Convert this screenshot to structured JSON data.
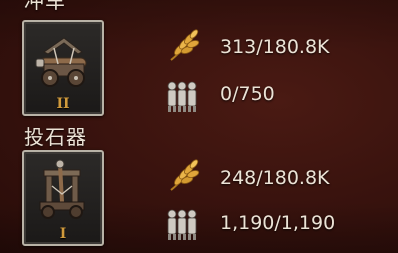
{
  "units": [
    {
      "name": "冲车",
      "tier": "II",
      "icon": "battering-ram-icon",
      "food": "313/180.8K",
      "troops": "0/750"
    },
    {
      "name": "投石器",
      "tier": "I",
      "icon": "catapult-icon",
      "food": "248/180.8K",
      "troops": "1,190/1,190"
    }
  ],
  "stat_icons": {
    "food": "wheat-icon",
    "troops": "soldiers-icon"
  },
  "colors": {
    "background": "#3a130e",
    "text": "#ece3d6",
    "tier": "#d09a3c",
    "wheat": "#e0a63a",
    "card_border": "#b8b2a6"
  }
}
